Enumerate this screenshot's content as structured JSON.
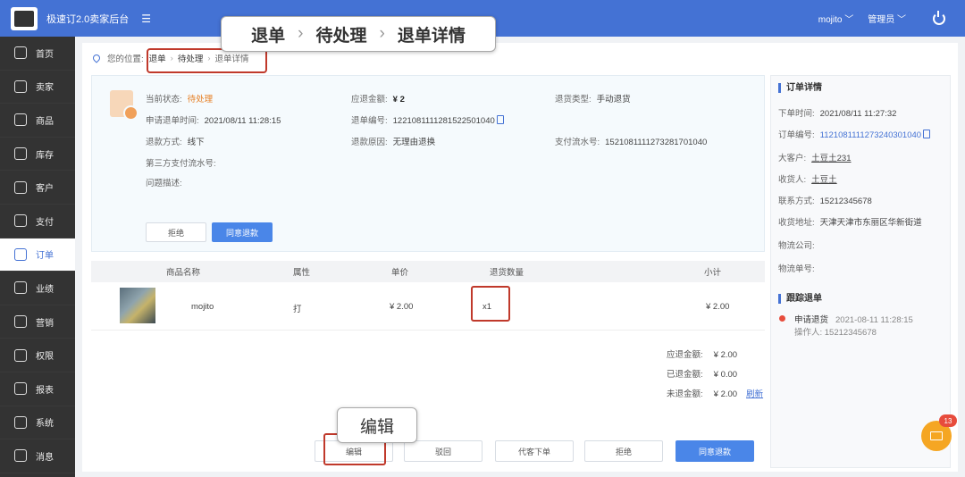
{
  "app": {
    "title": "极速订2.0卖家后台"
  },
  "topbar": {
    "user": "mojito ﹀",
    "role": "管理员 ﹀"
  },
  "sidebar": {
    "items": [
      {
        "label": "首页"
      },
      {
        "label": "卖家"
      },
      {
        "label": "商品"
      },
      {
        "label": "库存"
      },
      {
        "label": "客户"
      },
      {
        "label": "支付"
      },
      {
        "label": "订单"
      },
      {
        "label": "业绩"
      },
      {
        "label": "营销"
      },
      {
        "label": "权限"
      },
      {
        "label": "报表"
      },
      {
        "label": "系统"
      },
      {
        "label": "消息"
      }
    ],
    "active_index": 6
  },
  "breadcrumb": {
    "prefix": "您的位置:",
    "items": [
      "退单",
      "待处理",
      "退单详情"
    ],
    "sep": "›"
  },
  "callouts": {
    "crumb": [
      "退单",
      "待处理",
      "退单详情"
    ],
    "crumb_sep": "›",
    "edit": "编辑"
  },
  "refund": {
    "status_label": "当前状态:",
    "status": "待处理",
    "apply_time_label": "申请退单时间:",
    "apply_time": "2021/08/11 11:28:15",
    "method_label": "退款方式:",
    "method": "线下",
    "third_party_label": "第三方支付流水号:",
    "issue_label": "问题描述:",
    "amount_label": "应退金额:",
    "amount": "¥ 2",
    "refund_no_label": "退单编号:",
    "refund_no": "1221081111281522501040",
    "reason_label": "退款原因:",
    "reason": "无理由退换",
    "type_label": "退货类型:",
    "type": "手动退货",
    "pay_no_label": "支付流水号:",
    "pay_no": "1521081111273281701040",
    "reject_label": "拒绝",
    "approve_label": "同意退款"
  },
  "table": {
    "headers": [
      "商品名称",
      "属性",
      "单价",
      "退货数量",
      "小计"
    ],
    "rows": [
      {
        "name": "mojito",
        "attr": "打",
        "price": "¥ 2.00",
        "qty": "x1",
        "subtotal": "¥ 2.00"
      }
    ]
  },
  "summary": {
    "due_label": "应退金额:",
    "due": "¥ 2.00",
    "refunded_label": "已退金额:",
    "refunded": "¥ 0.00",
    "pending_label": "未退金额:",
    "pending": "¥ 2.00",
    "refresh": "刷新"
  },
  "bottom_buttons": {
    "edit": "编辑",
    "reject_back": "驳回",
    "proxy_order": "代客下单",
    "reject": "拒绝",
    "approve": "同意退款"
  },
  "order_detail": {
    "title": "订单详情",
    "order_time_label": "下单时间:",
    "order_time": "2021/08/11 11:27:32",
    "order_no_label": "订单编号:",
    "order_no": "1121081111273240301040",
    "customer_label": "大客户:",
    "customer": "土豆土231",
    "receiver_label": "收货人:",
    "receiver": "土豆土",
    "contact_label": "联系方式:",
    "contact": "15212345678",
    "address_label": "收货地址:",
    "address": "天津天津市东丽区华新街道",
    "logistics_label": "物流公司:",
    "tracking_label": "物流单号:"
  },
  "tracking": {
    "title": "跟踪退单",
    "event": "申请退货",
    "event_time": "2021-08-11 11:28:15",
    "operator": "操作人: 15212345678"
  },
  "messages": {
    "count": "13"
  }
}
